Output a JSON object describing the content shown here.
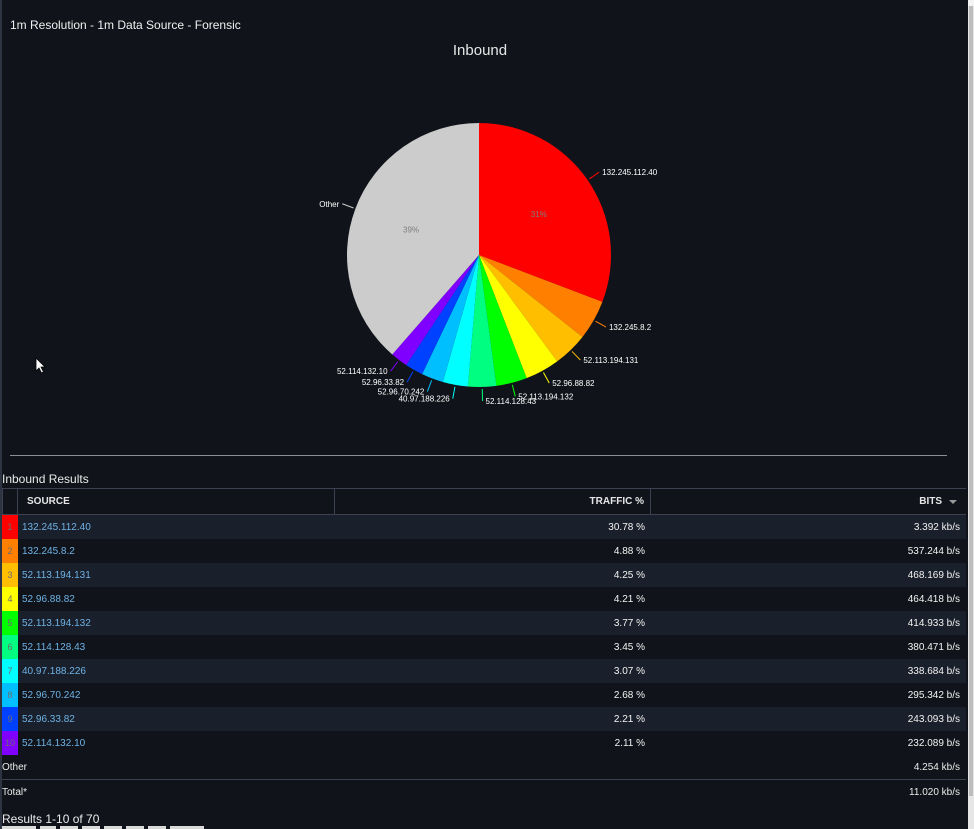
{
  "header": {
    "subtitle": "1m Resolution - 1m Data Source - Forensic"
  },
  "chart_data": {
    "type": "pie",
    "title": "Inbound",
    "start": "top, clockwise",
    "slices": [
      {
        "label": "132.245.112.40",
        "value": 30.78,
        "color": "#ff0000",
        "pct_label": "31%"
      },
      {
        "label": "132.245.8.2",
        "value": 4.88,
        "color": "#ff7f00"
      },
      {
        "label": "52.113.194.131",
        "value": 4.25,
        "color": "#ffbf00"
      },
      {
        "label": "52.96.88.82",
        "value": 4.21,
        "color": "#ffff00"
      },
      {
        "label": "52.113.194.132",
        "value": 3.77,
        "color": "#00ff00"
      },
      {
        "label": "52.114.128.43",
        "value": 3.45,
        "color": "#00ff80"
      },
      {
        "label": "40.97.188.226",
        "value": 3.07,
        "color": "#00ffff"
      },
      {
        "label": "52.96.70.242",
        "value": 2.68,
        "color": "#00bfff"
      },
      {
        "label": "52.96.33.82",
        "value": 2.21,
        "color": "#0040ff"
      },
      {
        "label": "52.114.132.10",
        "value": 2.11,
        "color": "#8000ff"
      },
      {
        "label": "Other",
        "value": 38.59,
        "color": "#cccccc",
        "pct_label": "39%"
      }
    ]
  },
  "table": {
    "title": "Inbound Results",
    "columns": {
      "source": "SOURCE",
      "traffic": "TRAFFIC %",
      "bits": "BITS"
    },
    "sort_icon": "caret-down-icon",
    "rows": [
      {
        "rank": "1",
        "source": "132.245.112.40",
        "traffic": "30.78 %",
        "bits": "3.392 kb/s",
        "color": "#ff0000"
      },
      {
        "rank": "2",
        "source": "132.245.8.2",
        "traffic": "4.88 %",
        "bits": "537.244 b/s",
        "color": "#ff7f00"
      },
      {
        "rank": "3",
        "source": "52.113.194.131",
        "traffic": "4.25 %",
        "bits": "468.169 b/s",
        "color": "#ffbf00"
      },
      {
        "rank": "4",
        "source": "52.96.88.82",
        "traffic": "4.21 %",
        "bits": "464.418 b/s",
        "color": "#ffff00"
      },
      {
        "rank": "5",
        "source": "52.113.194.132",
        "traffic": "3.77 %",
        "bits": "414.933 b/s",
        "color": "#00ff00"
      },
      {
        "rank": "6",
        "source": "52.114.128.43",
        "traffic": "3.45 %",
        "bits": "380.471 b/s",
        "color": "#00ff80"
      },
      {
        "rank": "7",
        "source": "40.97.188.226",
        "traffic": "3.07 %",
        "bits": "338.684 b/s",
        "color": "#00ffff"
      },
      {
        "rank": "8",
        "source": "52.96.70.242",
        "traffic": "2.68 %",
        "bits": "295.342 b/s",
        "color": "#00bfff"
      },
      {
        "rank": "9",
        "source": "52.96.33.82",
        "traffic": "2.21 %",
        "bits": "243.093 b/s",
        "color": "#0040ff"
      },
      {
        "rank": "10",
        "source": "52.114.132.10",
        "traffic": "2.11 %",
        "bits": "232.089 b/s",
        "color": "#8000ff"
      }
    ],
    "other": {
      "label": "Other",
      "bits": "4.254 kb/s"
    },
    "total": {
      "label": "Total*",
      "bits": "11.020 kb/s"
    }
  },
  "footer": {
    "results_count": "Results 1-10 of 70"
  }
}
